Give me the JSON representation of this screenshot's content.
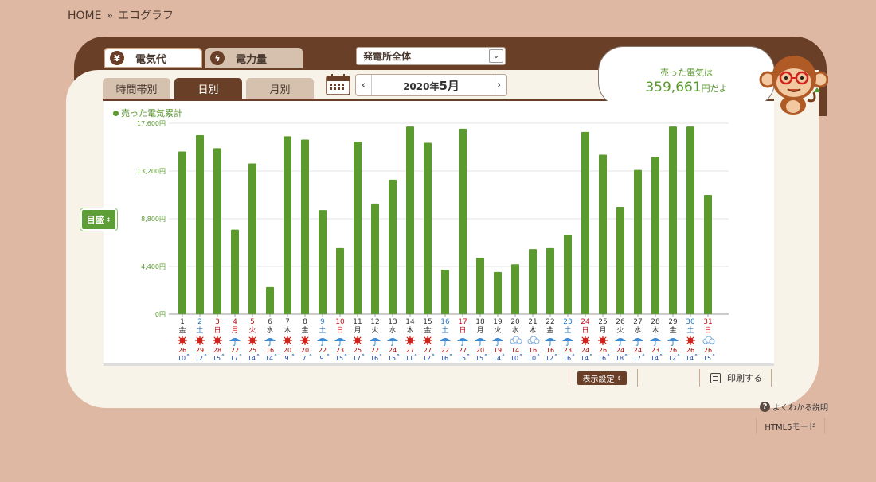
{
  "breadcrumb": {
    "home": "HOME",
    "sep": "»",
    "current": "エコグラフ"
  },
  "tabs": {
    "money": "電気代",
    "energy": "電力量"
  },
  "plant_select": {
    "value": "発電所全体"
  },
  "period_tabs": {
    "hour": "時間帯別",
    "day": "日別",
    "month": "月別"
  },
  "date_nav": {
    "year": "2020年",
    "month": "5月",
    "prev": "‹",
    "next": "›"
  },
  "bubble": {
    "line1": "売った電気は",
    "amount": "359,661",
    "suffix": "円だよ"
  },
  "legend": "売った電気累計",
  "side_button": "目盛",
  "footer": {
    "display": "表示設定",
    "print": "印刷する",
    "help": "よくわかる説明",
    "html5": "HTML5モード"
  },
  "colors": {
    "bar": "#5a9a2e",
    "brown": "#6a3f28",
    "sun": "#d0231b",
    "rain": "#3a8ad6",
    "cloud": "#7aaad8"
  },
  "chart_data": {
    "type": "bar",
    "y_unit": "円",
    "ylim": [
      0,
      17600
    ],
    "yticks": [
      0,
      4400,
      8800,
      13200,
      17600
    ],
    "ytick_labels": [
      "0円",
      "4,400円",
      "8,800円",
      "13,200円",
      "17,600円"
    ],
    "series": [
      {
        "name": "売った電気累計",
        "values": [
          15000,
          16500,
          15300,
          7800,
          13900,
          2500,
          16400,
          16100,
          9600,
          6100,
          15900,
          10200,
          12400,
          17300,
          15800,
          4100,
          17100,
          5200,
          3900,
          4600,
          6000,
          6100,
          7300,
          16800,
          14700,
          9900,
          13300,
          14500,
          17300,
          17300,
          11000
        ]
      }
    ],
    "days": [
      {
        "d": "1",
        "w": "金",
        "c": "n",
        "wx": "sun",
        "hi": "26",
        "lo": "10"
      },
      {
        "d": "2",
        "w": "土",
        "c": "b",
        "wx": "sun",
        "hi": "29",
        "lo": "12"
      },
      {
        "d": "3",
        "w": "日",
        "c": "r",
        "wx": "sun",
        "hi": "28",
        "lo": "15"
      },
      {
        "d": "4",
        "w": "月",
        "c": "r",
        "wx": "rain",
        "hi": "22",
        "lo": "17"
      },
      {
        "d": "5",
        "w": "火",
        "c": "r",
        "wx": "sun",
        "hi": "25",
        "lo": "14"
      },
      {
        "d": "6",
        "w": "水",
        "c": "n",
        "wx": "rain",
        "hi": "16",
        "lo": "14"
      },
      {
        "d": "7",
        "w": "木",
        "c": "n",
        "wx": "sun",
        "hi": "20",
        "lo": "9"
      },
      {
        "d": "8",
        "w": "金",
        "c": "n",
        "wx": "sun",
        "hi": "20",
        "lo": "7"
      },
      {
        "d": "9",
        "w": "土",
        "c": "b",
        "wx": "rain",
        "hi": "22",
        "lo": "9"
      },
      {
        "d": "10",
        "w": "日",
        "c": "r",
        "wx": "rain",
        "hi": "23",
        "lo": "15"
      },
      {
        "d": "11",
        "w": "月",
        "c": "n",
        "wx": "sun",
        "hi": "25",
        "lo": "17"
      },
      {
        "d": "12",
        "w": "火",
        "c": "n",
        "wx": "rain",
        "hi": "22",
        "lo": "16"
      },
      {
        "d": "13",
        "w": "水",
        "c": "n",
        "wx": "rain",
        "hi": "24",
        "lo": "15"
      },
      {
        "d": "14",
        "w": "木",
        "c": "n",
        "wx": "sun",
        "hi": "27",
        "lo": "11"
      },
      {
        "d": "15",
        "w": "金",
        "c": "n",
        "wx": "sun",
        "hi": "27",
        "lo": "12"
      },
      {
        "d": "16",
        "w": "土",
        "c": "b",
        "wx": "rain",
        "hi": "22",
        "lo": "16"
      },
      {
        "d": "17",
        "w": "日",
        "c": "r",
        "wx": "rain",
        "hi": "27",
        "lo": "15"
      },
      {
        "d": "18",
        "w": "月",
        "c": "n",
        "wx": "rain",
        "hi": "20",
        "lo": "15"
      },
      {
        "d": "19",
        "w": "火",
        "c": "n",
        "wx": "rain",
        "hi": "19",
        "lo": "14"
      },
      {
        "d": "20",
        "w": "水",
        "c": "n",
        "wx": "cloud",
        "hi": "14",
        "lo": "10"
      },
      {
        "d": "21",
        "w": "木",
        "c": "n",
        "wx": "cloud",
        "hi": "16",
        "lo": "10"
      },
      {
        "d": "22",
        "w": "金",
        "c": "n",
        "wx": "rain",
        "hi": "16",
        "lo": "12"
      },
      {
        "d": "23",
        "w": "土",
        "c": "b",
        "wx": "rain",
        "hi": "23",
        "lo": "16"
      },
      {
        "d": "24",
        "w": "日",
        "c": "r",
        "wx": "sun",
        "hi": "24",
        "lo": "14"
      },
      {
        "d": "25",
        "w": "月",
        "c": "n",
        "wx": "sun",
        "hi": "26",
        "lo": "16"
      },
      {
        "d": "26",
        "w": "火",
        "c": "n",
        "wx": "rain",
        "hi": "24",
        "lo": "18"
      },
      {
        "d": "27",
        "w": "水",
        "c": "n",
        "wx": "rain",
        "hi": "24",
        "lo": "17"
      },
      {
        "d": "28",
        "w": "木",
        "c": "n",
        "wx": "rain",
        "hi": "23",
        "lo": "14"
      },
      {
        "d": "29",
        "w": "金",
        "c": "n",
        "wx": "rain",
        "hi": "26",
        "lo": "12"
      },
      {
        "d": "30",
        "w": "土",
        "c": "b",
        "wx": "sun",
        "hi": "26",
        "lo": "14"
      },
      {
        "d": "31",
        "w": "日",
        "c": "r",
        "wx": "cloud",
        "hi": "26",
        "lo": "15"
      }
    ],
    "deg": "°"
  }
}
